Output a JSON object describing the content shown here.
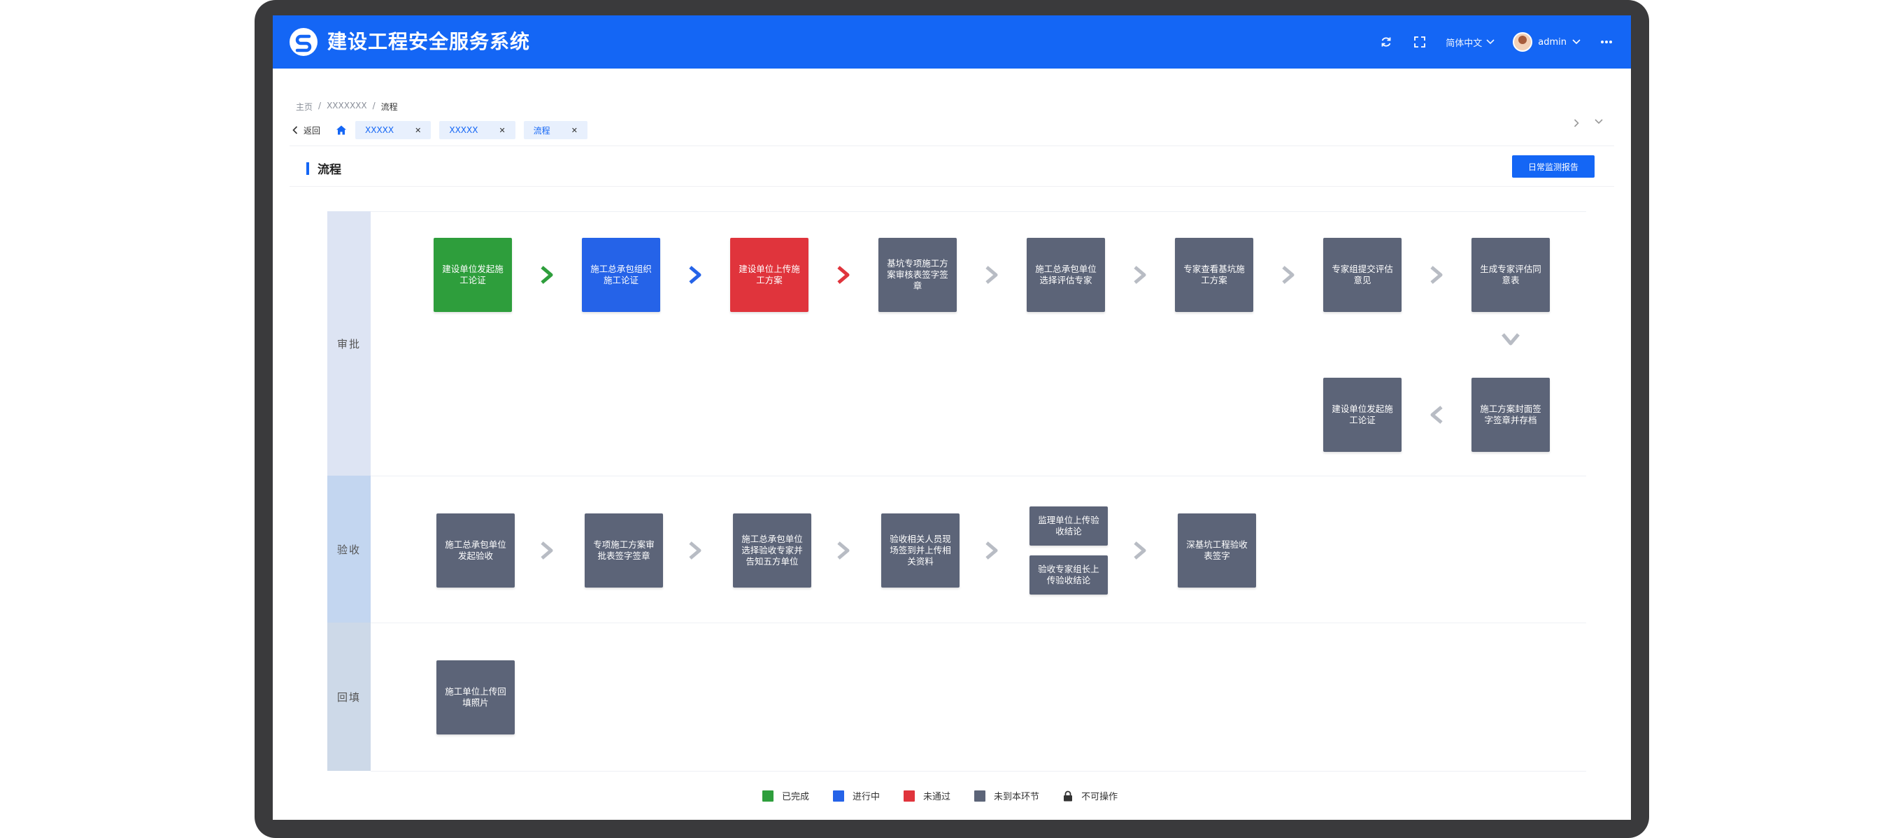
{
  "header": {
    "app_title": "建设工程安全服务系统",
    "language": "简体中文",
    "user": "admin"
  },
  "breadcrumb": [
    "主页",
    "XXXXXXX",
    "流程"
  ],
  "tabs": {
    "back_label": "返回",
    "items": [
      {
        "label": "XXXXX"
      },
      {
        "label": "XXXXX"
      },
      {
        "label": "流程"
      }
    ]
  },
  "page": {
    "title": "流程",
    "report_button": "日常监测报告"
  },
  "lanes": [
    {
      "label": "审批"
    },
    {
      "label": "验收"
    },
    {
      "label": "回填"
    }
  ],
  "nodes": {
    "approval": [
      {
        "text": "建设单位发起施工论证",
        "status": "done"
      },
      {
        "text": "施工总承包组织施工论证",
        "status": "doing"
      },
      {
        "text": "建设单位上传施工方案",
        "status": "fail"
      },
      {
        "text": "基坑专项施工方案审核表签字签章",
        "status": "todo"
      },
      {
        "text": "施工总承包单位选择评估专家",
        "status": "todo"
      },
      {
        "text": "专家查看基坑施工方案",
        "status": "todo"
      },
      {
        "text": "专家组提交评估意见",
        "status": "todo"
      },
      {
        "text": "生成专家评估同意表",
        "status": "todo"
      },
      {
        "text": "施工方案封面签字签章并存档",
        "status": "todo"
      },
      {
        "text": "建设单位发起施工论证",
        "status": "todo"
      }
    ],
    "acceptance": [
      {
        "text": "施工总承包单位发起验收",
        "status": "todo"
      },
      {
        "text": "专项施工方案审批表签字签章",
        "status": "todo"
      },
      {
        "text": "施工总承包单位选择验收专家并告知五方单位",
        "status": "todo"
      },
      {
        "text": "验收相关人员现场签到并上传相关资料",
        "status": "todo"
      },
      {
        "text": "监理单位上传验收结论",
        "status": "todo"
      },
      {
        "text": "验收专家组长上传验收结论",
        "status": "todo"
      },
      {
        "text": "深基坑工程验收表签字",
        "status": "todo"
      }
    ],
    "backfill": [
      {
        "text": "施工单位上传回填照片",
        "status": "todo"
      }
    ]
  },
  "legend": [
    {
      "label": "已完成",
      "color": "#2e9e3c"
    },
    {
      "label": "进行中",
      "color": "#2563e8"
    },
    {
      "label": "未通过",
      "color": "#e0343c"
    },
    {
      "label": "未到本环节",
      "color": "#5c6478"
    },
    {
      "label": "不可操作",
      "icon": "lock-icon"
    }
  ],
  "colors": {
    "primary": "#1466f5",
    "done": "#2e9e3c",
    "doing": "#2563e8",
    "fail": "#e0343c",
    "todo": "#5c6478",
    "lane_approval": "#dde4f3",
    "lane_acceptance": "#c3d6f0",
    "lane_backfill": "#cdd9e8"
  }
}
